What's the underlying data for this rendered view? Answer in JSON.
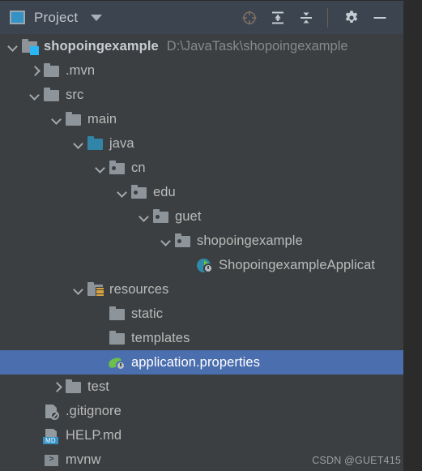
{
  "toolbar": {
    "window_icon": "project-window-icon",
    "title": "Project",
    "dropdown_icon": "chevron-down-icon",
    "actions": [
      {
        "name": "locate-icon",
        "glyph": "scope"
      },
      {
        "name": "expand-all-icon",
        "glyph": "expand"
      },
      {
        "name": "collapse-all-icon",
        "glyph": "collapse"
      },
      {
        "name": "settings-icon",
        "glyph": "gear"
      },
      {
        "name": "hide-icon",
        "glyph": "minus"
      }
    ]
  },
  "tree": {
    "rows": [
      {
        "label": "shopoingexample",
        "path": "D:\\JavaTask\\shopoingexample",
        "indent": 0,
        "state": "expanded",
        "icon": "module-folder-icon",
        "bold": true,
        "selected": false
      },
      {
        "label": ".mvn",
        "path": "",
        "indent": 1,
        "state": "collapsed",
        "icon": "folder-icon",
        "bold": false,
        "selected": false
      },
      {
        "label": "src",
        "path": "",
        "indent": 1,
        "state": "expanded",
        "icon": "folder-icon",
        "bold": false,
        "selected": false
      },
      {
        "label": "main",
        "path": "",
        "indent": 2,
        "state": "expanded",
        "icon": "folder-icon",
        "bold": false,
        "selected": false
      },
      {
        "label": "java",
        "path": "",
        "indent": 3,
        "state": "expanded",
        "icon": "source-root-folder-icon",
        "bold": false,
        "selected": false
      },
      {
        "label": "cn",
        "path": "",
        "indent": 4,
        "state": "expanded",
        "icon": "package-icon",
        "bold": false,
        "selected": false
      },
      {
        "label": "edu",
        "path": "",
        "indent": 5,
        "state": "expanded",
        "icon": "package-icon",
        "bold": false,
        "selected": false
      },
      {
        "label": "guet",
        "path": "",
        "indent": 6,
        "state": "expanded",
        "icon": "package-icon",
        "bold": false,
        "selected": false
      },
      {
        "label": "shopoingexample",
        "path": "",
        "indent": 7,
        "state": "expanded",
        "icon": "package-icon",
        "bold": false,
        "selected": false
      },
      {
        "label": "ShopoingexampleApplicat",
        "path": "",
        "indent": 8,
        "state": "leaf",
        "icon": "spring-boot-class-icon",
        "bold": false,
        "selected": false
      },
      {
        "label": "resources",
        "path": "",
        "indent": 3,
        "state": "expanded",
        "icon": "resource-root-folder-icon",
        "bold": false,
        "selected": false
      },
      {
        "label": "static",
        "path": "",
        "indent": 4,
        "state": "leaf",
        "icon": "folder-icon",
        "bold": false,
        "selected": false
      },
      {
        "label": "templates",
        "path": "",
        "indent": 4,
        "state": "leaf",
        "icon": "folder-icon",
        "bold": false,
        "selected": false
      },
      {
        "label": "application.properties",
        "path": "",
        "indent": 4,
        "state": "leaf",
        "icon": "spring-properties-icon",
        "bold": false,
        "selected": true
      },
      {
        "label": "test",
        "path": "",
        "indent": 2,
        "state": "collapsed",
        "icon": "folder-icon",
        "bold": false,
        "selected": false
      },
      {
        "label": ".gitignore",
        "path": "",
        "indent": 1,
        "state": "leaf",
        "icon": "gitignore-file-icon",
        "bold": false,
        "selected": false
      },
      {
        "label": "HELP.md",
        "path": "",
        "indent": 1,
        "state": "leaf",
        "icon": "markdown-file-icon",
        "bold": false,
        "selected": false
      },
      {
        "label": "mvnw",
        "path": "",
        "indent": 1,
        "state": "leaf",
        "icon": "script-file-icon",
        "bold": false,
        "selected": false
      }
    ]
  },
  "markdown_badge": "MD",
  "script_badge": ">",
  "watermark": "CSDN @GUET415",
  "colors": {
    "toolbar_bg": "#3c4450",
    "tree_bg": "#3c3f41",
    "selection": "#4b6eaf",
    "text": "#bbbbbb",
    "path_text": "#868a8d",
    "outside": "#2b2b2b",
    "source_root": "#3085a8",
    "spring_green": "#6cbf4b",
    "module_accent": "#29b6f6"
  }
}
